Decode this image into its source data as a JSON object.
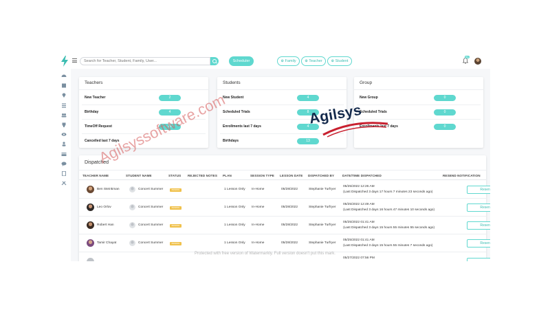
{
  "search": {
    "placeholder": "Search for Teacher, Student, Family, User..."
  },
  "toolbar": {
    "scheduler_label": "Scheduler",
    "family_label": "Family",
    "teacher_label": "Teacher",
    "student_label": "Student",
    "notification_badge": "99+"
  },
  "sidebar": {
    "icons": [
      "dashboard-icon",
      "calendar-icon",
      "location-icon",
      "list-icon",
      "users-icon",
      "trophy-icon",
      "view-icon",
      "person-icon",
      "card-icon",
      "chat-icon",
      "document-icon",
      "tools-icon"
    ]
  },
  "teachers_card": {
    "title": "Teachers",
    "rows": [
      {
        "label": "New Teacher",
        "value": "2"
      },
      {
        "label": "Birthday",
        "value": "4"
      },
      {
        "label": "TimeOff Request",
        "value": "21"
      },
      {
        "label": "Cancelled last 7 days",
        "value": ""
      }
    ]
  },
  "students_card": {
    "title": "Students",
    "rows": [
      {
        "label": "New Student",
        "value": "4"
      },
      {
        "label": "Scheduled Trials",
        "value": "8"
      },
      {
        "label": "Enrollments last 7 days",
        "value": "4"
      },
      {
        "label": "Birthdays",
        "value": "13"
      }
    ]
  },
  "group_card": {
    "title": "Group",
    "rows": [
      {
        "label": "New Group",
        "value": "0"
      },
      {
        "label": "Scheduled Trials",
        "value": "0"
      },
      {
        "label": "Enrollments last 7 days",
        "value": "0"
      }
    ]
  },
  "dispatched": {
    "title": "Dispatched",
    "headers": {
      "teacher": "TEACHER NAME",
      "student": "STUDENT NAME",
      "status": "STATUS",
      "notes": "REJECTED NOTES",
      "plan": "PLAN",
      "session": "SESSION TYPE",
      "lesson_date": "LESSON DATE",
      "dispatched_by": "DISPATCHED BY",
      "datetime": "DATE/TIME DISPATCHED",
      "resend": "RESEND NOTIFICATION"
    },
    "rows": [
      {
        "teacher": "Ben Steinkman",
        "student": "Concert Summer",
        "status": "PENDING",
        "plan": "1 Lesson Only",
        "session": "In-Home",
        "lesson_date": "05/28/2022",
        "dispatched_by": "Stephanie Turfryer",
        "datetime": "05/25/2022 12:26 AM",
        "last": "(Last Dispatched 3 days 17 hours 7 minutes 23 seconds ago)",
        "resend": "Resend"
      },
      {
        "teacher": "Leo Orlov",
        "student": "Concert Summer",
        "status": "PENDING",
        "plan": "1 Lesson Only",
        "session": "In-Home",
        "lesson_date": "05/28/2022",
        "dispatched_by": "Stephanie Turfryer",
        "datetime": "05/25/2022 12:49 AM",
        "last": "(Last Dispatched 3 days 16 hours 47 minutes 10 seconds ago)",
        "resend": "Resend"
      },
      {
        "teacher": "Robert Han",
        "student": "Concert Summer",
        "status": "PENDING",
        "plan": "1 Lesson Only",
        "session": "In-Home",
        "lesson_date": "05/28/2022",
        "dispatched_by": "Stephanie Turfryer",
        "datetime": "05/25/2022 01:41 AM",
        "last": "(Last Dispatched 3 days 15 hours 55 minutes 55 seconds ago)",
        "resend": "Resend"
      },
      {
        "teacher": "Tamir Chayat",
        "student": "Concert Summer",
        "status": "PENDING",
        "plan": "1 Lesson Only",
        "session": "In-Home",
        "lesson_date": "05/28/2022",
        "dispatched_by": "Stephanie Turfryer",
        "datetime": "05/25/2022 01:41 AM",
        "last": "(Last Dispatched 3 days 15 hours 55 minutes 7 seconds ago)",
        "resend": "Resend"
      },
      {
        "teacher": "",
        "student": "",
        "status": "",
        "plan": "",
        "session": "",
        "lesson_date": "",
        "dispatched_by": "",
        "datetime": "05/27/2022 07:56 PM",
        "last": "",
        "resend": ""
      }
    ]
  },
  "watermarks": {
    "site": "Agilsyssoftware.com",
    "brand": "Agilsys",
    "note": "Protected with free version of Watermarkly. Full version doesn't put this mark."
  },
  "colors": {
    "accent": "#5fd8cf",
    "status_pending": "#f0c14b",
    "brand_navy": "#13294b",
    "brand_red": "#c8202f"
  }
}
